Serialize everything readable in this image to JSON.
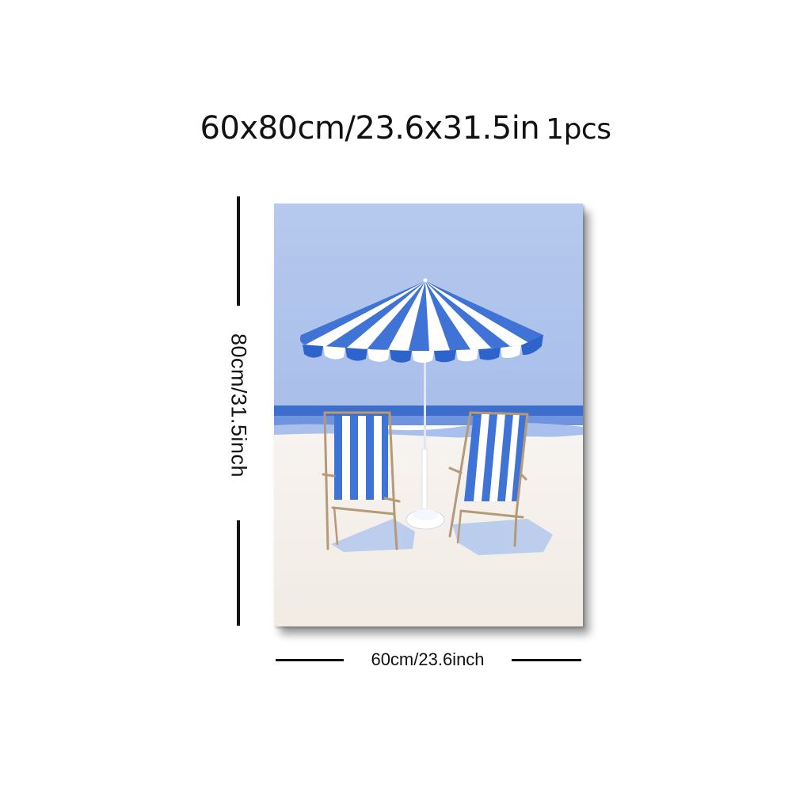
{
  "header": {
    "size_text": "60x80cm/23.6x31.5in",
    "quantity_text": "1pcs"
  },
  "dimensions": {
    "height_label": "80cm/31.5inch",
    "width_label": "60cm/23.6inch"
  },
  "artwork": {
    "subject_icons": [
      "beach-umbrella-icon",
      "deck-chair-icon"
    ],
    "colors": {
      "sky": "#aec2ea",
      "sea": "#3f6ec9",
      "sand": "#f4efea",
      "stripe_blue": "#3f73d6",
      "wood": "#b59a78"
    }
  }
}
